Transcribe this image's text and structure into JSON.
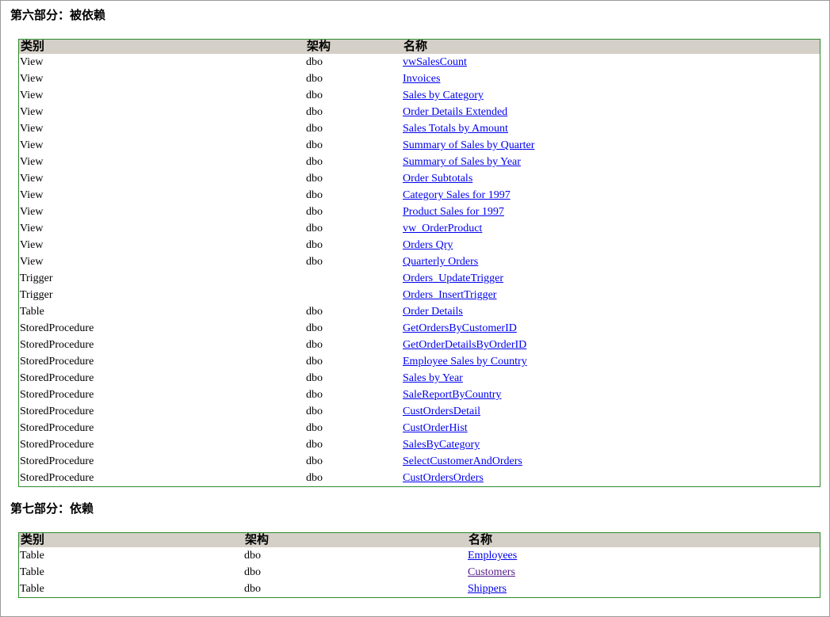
{
  "section6": {
    "title": "第六部分：被依赖",
    "headers": {
      "type": "类别",
      "schema": "架构",
      "name": "名称"
    },
    "rows": [
      {
        "type": "View",
        "schema": "dbo",
        "name": "vwSalesCount"
      },
      {
        "type": "View",
        "schema": "dbo",
        "name": "Invoices"
      },
      {
        "type": "View",
        "schema": "dbo",
        "name": "Sales by Category"
      },
      {
        "type": "View",
        "schema": "dbo",
        "name": "Order Details Extended"
      },
      {
        "type": "View",
        "schema": "dbo",
        "name": "Sales Totals by Amount"
      },
      {
        "type": "View",
        "schema": "dbo",
        "name": "Summary of Sales by Quarter"
      },
      {
        "type": "View",
        "schema": "dbo",
        "name": "Summary of Sales by Year"
      },
      {
        "type": "View",
        "schema": "dbo",
        "name": "Order Subtotals"
      },
      {
        "type": "View",
        "schema": "dbo",
        "name": "Category Sales for 1997"
      },
      {
        "type": "View",
        "schema": "dbo",
        "name": "Product Sales for 1997"
      },
      {
        "type": "View",
        "schema": "dbo",
        "name": "vw_OrderProduct"
      },
      {
        "type": "View",
        "schema": "dbo",
        "name": "Orders Qry"
      },
      {
        "type": "View",
        "schema": "dbo",
        "name": "Quarterly Orders"
      },
      {
        "type": "Trigger",
        "schema": "",
        "name": "Orders_UpdateTrigger"
      },
      {
        "type": "Trigger",
        "schema": "",
        "name": "Orders_InsertTrigger"
      },
      {
        "type": "Table",
        "schema": "dbo",
        "name": "Order Details"
      },
      {
        "type": "StoredProcedure",
        "schema": "dbo",
        "name": "GetOrdersByCustomerID"
      },
      {
        "type": "StoredProcedure",
        "schema": "dbo",
        "name": "GetOrderDetailsByOrderID"
      },
      {
        "type": "StoredProcedure",
        "schema": "dbo",
        "name": "Employee Sales by Country"
      },
      {
        "type": "StoredProcedure",
        "schema": "dbo",
        "name": "Sales by Year"
      },
      {
        "type": "StoredProcedure",
        "schema": "dbo",
        "name": "SaleReportByCountry"
      },
      {
        "type": "StoredProcedure",
        "schema": "dbo",
        "name": "CustOrdersDetail"
      },
      {
        "type": "StoredProcedure",
        "schema": "dbo",
        "name": "CustOrderHist"
      },
      {
        "type": "StoredProcedure",
        "schema": "dbo",
        "name": "SalesByCategory"
      },
      {
        "type": "StoredProcedure",
        "schema": "dbo",
        "name": "SelectCustomerAndOrders"
      },
      {
        "type": "StoredProcedure",
        "schema": "dbo",
        "name": "CustOrdersOrders"
      }
    ]
  },
  "section7": {
    "title": "第七部分：依赖",
    "headers": {
      "type": "类别",
      "schema": "架构",
      "name": "名称"
    },
    "rows": [
      {
        "type": "Table",
        "schema": "dbo",
        "name": "Employees",
        "visited": false
      },
      {
        "type": "Table",
        "schema": "dbo",
        "name": "Customers",
        "visited": true
      },
      {
        "type": "Table",
        "schema": "dbo",
        "name": "Shippers",
        "visited": false
      }
    ]
  },
  "colors": {
    "panel_border": "#2e8b2e",
    "header_bg": "#d4d0c8",
    "link": "#0000ee",
    "visited_link": "#551a8b"
  }
}
